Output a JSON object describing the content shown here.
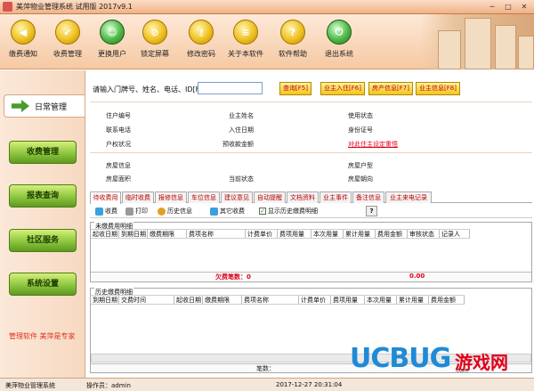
{
  "window": {
    "title": "美萍物业管理系统 试用版 2017v9.1"
  },
  "toolbar": {
    "items": [
      {
        "label": "缴费通知",
        "icon": "megaphone-icon"
      },
      {
        "label": "收费管理",
        "icon": "checklist-icon"
      },
      {
        "label": "更换用户",
        "icon": "user-swap-icon"
      },
      {
        "label": "锁定屏幕",
        "icon": "no-entry-icon"
      },
      {
        "label": "修改密码",
        "icon": "key-icon"
      },
      {
        "label": "关于本软件",
        "icon": "document-icon"
      },
      {
        "label": "软件帮助",
        "icon": "help-icon"
      },
      {
        "label": "退出系统",
        "icon": "power-icon"
      }
    ]
  },
  "sidebar": {
    "active": "日常管理",
    "items": [
      "收费管理",
      "报表查询",
      "社区服务",
      "系统设置"
    ],
    "footer": "管理软件 美萍是专家"
  },
  "search": {
    "label": "请输入门牌号、姓名、电话、ID[F2]",
    "value": ""
  },
  "actions": [
    "查询[F5]",
    "业主入住[F6]",
    "房产信息[F7]",
    "业主信息[F8]"
  ],
  "info": {
    "row1": [
      "住户编号",
      "业主姓名",
      "使用状态"
    ],
    "row2": [
      "联系电话",
      "入住日期",
      "身份证号"
    ],
    "row3": [
      "户权状况",
      "预收款金额"
    ],
    "row3_link": "对此住主设定重悟",
    "row4": [
      "房屋信息",
      "房屋户型"
    ],
    "row5": [
      "房屋面积",
      "当前状态",
      "房屋朝向"
    ]
  },
  "tabs": [
    "待收费用",
    "临时收费",
    "报修信息",
    "车位信息",
    "建议意见",
    "自动提醒",
    "文档资料",
    "业主事件",
    "备注信息",
    "业主来电记录"
  ],
  "subtoolbar": {
    "charge": "收费",
    "print": "打印",
    "history": "历史信息",
    "other": "其它收费",
    "show_history": "显示历史缴费明细",
    "help": "?"
  },
  "unpaid": {
    "title": "未缴费用明细",
    "columns": [
      "起收日期",
      "到期日期",
      "缴费期限",
      "费项名称",
      "计费单价",
      "费项用量",
      "本次用量",
      "累计用量",
      "费用金额",
      "审核状态",
      "记录人"
    ],
    "summary_label": "欠费笔数：0",
    "summary_amount": "0.00"
  },
  "history": {
    "title": "历史缴费明细",
    "columns": [
      "到期日期",
      "交费时间",
      "起收日期",
      "缴费期限",
      "费项名称",
      "计费单价",
      "费项用量",
      "本次用量",
      "累计用量",
      "费用金额"
    ],
    "summary_label": "笔数："
  },
  "status": {
    "app": "美萍物业管理系统",
    "operator": "操作员：admin",
    "datetime": "2017-12-27 20:31:04"
  },
  "watermark": {
    "logo": "UCBUG",
    "cn": "游戏网",
    "url": ".com"
  },
  "colors": {
    "accent_red": "#e0001a",
    "button_yellow": "#f5c518",
    "side_green": "#8cc63f"
  }
}
